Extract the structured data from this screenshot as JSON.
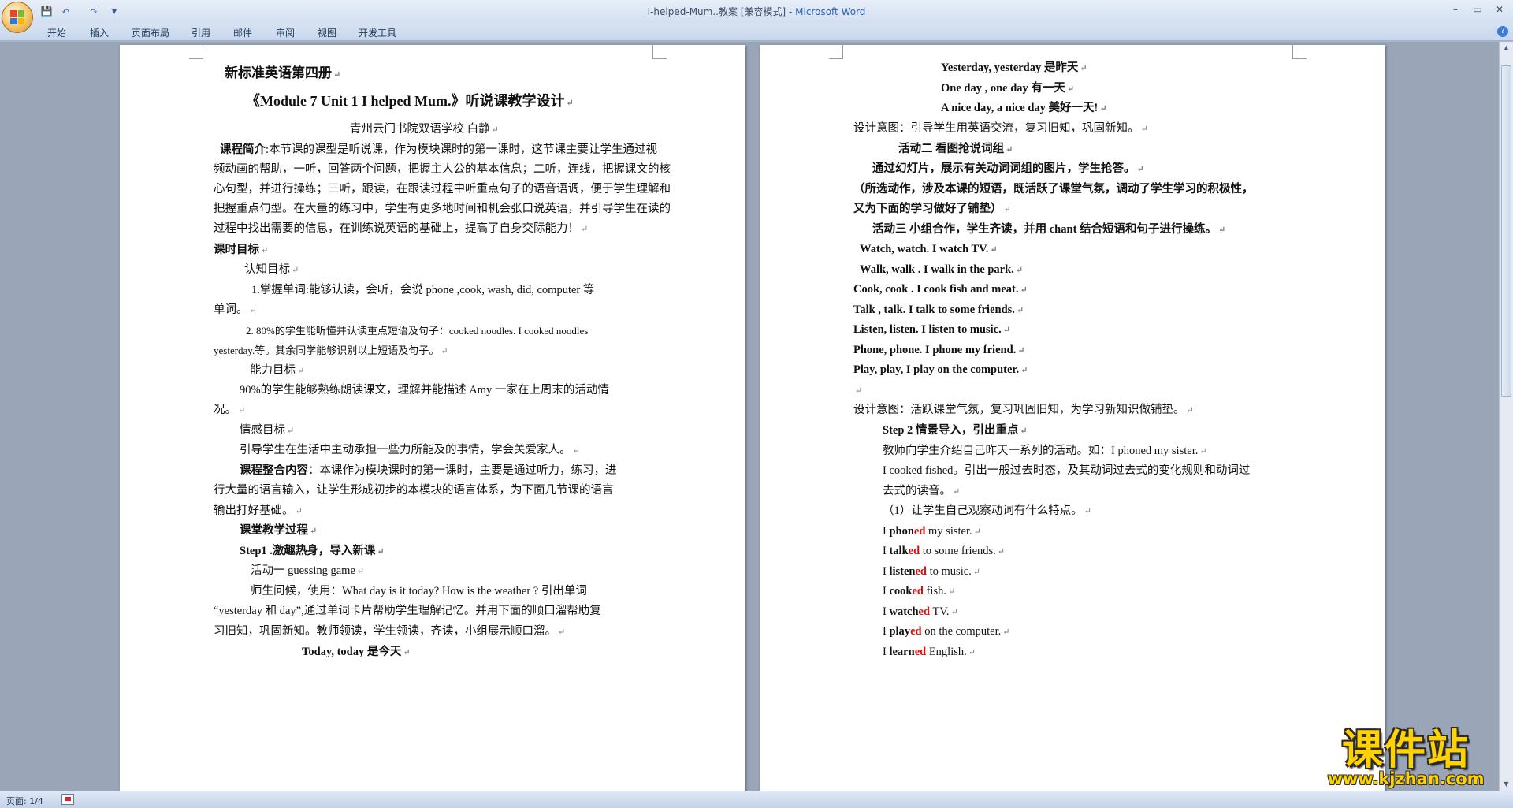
{
  "window": {
    "title_doc": "I-helped-Mum..教案 [兼容模式] -",
    "title_app": "Microsoft Word",
    "minimize": "–",
    "restore": "▭",
    "close": "✕"
  },
  "quick_access": {
    "save": "💾",
    "undo": "↶",
    "redo": "↷",
    "customize": "▾"
  },
  "tabs": [
    "开始",
    "插入",
    "页面布局",
    "引用",
    "邮件",
    "审阅",
    "视图",
    "开发工具"
  ],
  "help": "?",
  "page1": {
    "header": "新标准英语第四册",
    "title": "《Module 7 Unit 1 I helped Mum.》听说课教学设计",
    "author": "青州云门书院双语学校    白静",
    "intro_label": "课程简介",
    "intro_lines": [
      ":本节课的课型是听说课，作为模块课时的第一课时，这节课主要让学生通过视",
      "频动画的帮助，一听，回答两个问题，把握主人公的基本信息；二听，连线，把握课文的核",
      "心句型，并进行操练；三听，跟读，在跟读过程中听重点句子的语音语调，便于学生理解和",
      "把握重点句型。在大量的练习中，学生有更多地时间和机会张口说英语，并引导学生在读的",
      "过程中找出需要的信息，在训练说英语的基础上，提高了自身交际能力！"
    ],
    "goals_title": "课时目标",
    "cog_title": "认知目标",
    "cog1a": "1.掌握单词:能够认读，会听，会说  phone ,cook,   wash, did, computer 等",
    "cog1b": "单词。",
    "cog2a": "2.  80%的学生能听懂并认读重点短语及句子：cooked  noodles.  I  cooked  noodles",
    "cog2b": "yesterday.等。其余同学能够识别以上短语及句子。",
    "ability_title": "能力目标",
    "ability_a": "90%的学生能够熟练朗读课文，理解并能描述 Amy 一家在上周末的活动情",
    "ability_b": "况。",
    "emotion_title": "情感目标",
    "emotion_text": "引导学生在生活中主动承担一些力所能及的事情，学会关爱家人。",
    "integ_label": "课程整合内容",
    "integ_lines": [
      "：本课作为模块课时的第一课时，主要是通过听力，练习，进",
      "行大量的语言输入，让学生形成初步的本模块的语言体系，为下面几节课的语言",
      "输出打好基础。"
    ],
    "process_title": "课堂教学过程",
    "step1": "Step1 .激趣热身，导入新课",
    "act1": "活动一  guessing game",
    "greet_lines": [
      "师生问候，使用：What day is it today? How is the weather ? 引出单词",
      "“yesterday 和 day”,通过单词卡片帮助学生理解记忆。并用下面的顺口溜帮助复",
      "习旧知，巩固新知。教师领读，学生领读，齐读，小组展示顺口溜。"
    ],
    "chant_today": "Today, today  是今天"
  },
  "page2": {
    "chant": [
      "Yesterday, yesterday  是昨天",
      "One day , one day  有一天",
      "A nice day, a nice day  美好一天!"
    ],
    "design1": "设计意图：引导学生用英语交流，复习旧知，巩固新知。",
    "act2": "活动二  看图抢说词组",
    "act2_desc": "通过幻灯片，展示有关动词词组的图片，学生抢答。",
    "act2_note1": "（所选动作，涉及本课的短语，既活跃了课堂气氛，调动了学生学习的积极性，",
    "act2_note2": "又为下面的学习做好了铺垫）",
    "act3": "活动三  小组合作，学生齐读，并用 chant 结合短语和句子进行操练。",
    "phrases": [
      "Watch, watch. I watch TV.",
      "Walk, walk . I walk in the park.",
      "Cook, cook . I cook fish and meat.",
      "Talk , talk. I talk to some friends.",
      "Listen, listen.  I listen  to music.",
      "Phone, phone. I phone my friend.",
      "Play, play, I play on the computer."
    ],
    "blank_mark": "↵",
    "design2": "设计意图：活跃课堂气氛，复习巩固旧知，为学习新知识做铺垫。",
    "step2": "Step 2  情景导入，引出重点",
    "step2_l1": "教师向学生介绍自己昨天一系列的活动。如：I phoned my sister.",
    "step2_l2": "I cooked fished。引出一般过去时态，及其动词过去式的变化规则和动词过",
    "step2_l3": "去式的读音。",
    "observe": "（1）让学生自己观察动词有什么特点。",
    "past_verbs": [
      {
        "pre": "I ",
        "stem": "phon",
        "suf": "ed",
        "post": " my sister."
      },
      {
        "pre": "I ",
        "stem": "talk",
        "suf": "ed",
        "post": " to some friends."
      },
      {
        "pre": "I ",
        "stem": "listen",
        "suf": "ed",
        "post": "  to music."
      },
      {
        "pre": "I ",
        "stem": "cook",
        "suf": "ed",
        "post": " fish."
      },
      {
        "pre": "I ",
        "stem": "watch",
        "suf": "ed",
        "post": " TV."
      },
      {
        "pre": "I ",
        "stem": "play",
        "suf": "ed",
        "post": " on the computer."
      },
      {
        "pre": "I ",
        "stem": "learn",
        "suf": "ed",
        "post": " English."
      }
    ]
  },
  "status": {
    "page": "页面: 1/4"
  },
  "watermark": {
    "title": "课件站",
    "url": "www.kjzhan.com"
  },
  "colors": {
    "accent_red": "#e01010",
    "watermark_yellow": "#ffd200",
    "ribbon_blue": "#c8d7ec"
  }
}
